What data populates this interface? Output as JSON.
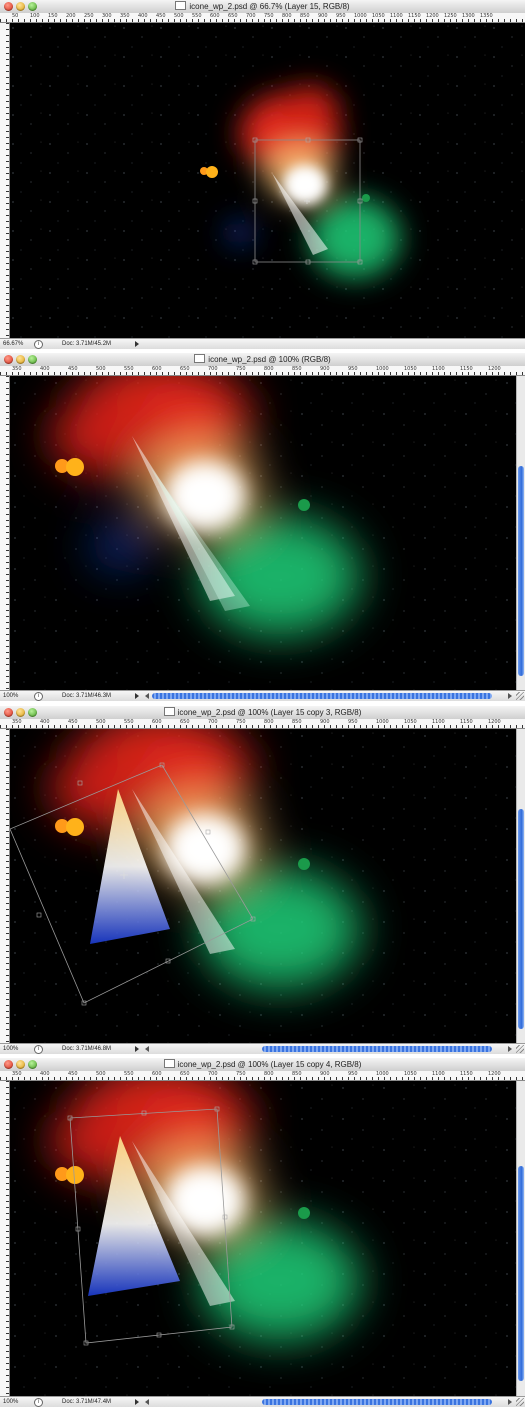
{
  "windows": [
    {
      "title": "icone_wp_2.psd @ 66.7% (Layer 15, RGB/8)",
      "zoom": "66.67%",
      "doc_size": "Doc: 3.71M/45.2M",
      "ruler_ticks": [
        "50",
        "100",
        "150",
        "200",
        "250",
        "300",
        "350",
        "400",
        "450",
        "500",
        "550",
        "600",
        "650",
        "700",
        "750",
        "800",
        "850",
        "900",
        "950",
        "1000",
        "1050",
        "1100",
        "1150",
        "1200",
        "1250",
        "1300",
        "1350"
      ],
      "has_hscroll": false,
      "has_vscroll": false
    },
    {
      "title": "icone_wp_2.psd @ 100% (RGB/8)",
      "zoom": "100%",
      "doc_size": "Doc: 3.71M/46.3M",
      "ruler_ticks": [
        "350",
        "400",
        "450",
        "500",
        "550",
        "600",
        "650",
        "700",
        "750",
        "800",
        "850",
        "900",
        "950",
        "1000",
        "1050",
        "1100",
        "1150",
        "1200"
      ],
      "has_hscroll": true,
      "has_vscroll": true
    },
    {
      "title": "icone_wp_2.psd @ 100% (Layer 15 copy 3, RGB/8)",
      "zoom": "100%",
      "doc_size": "Doc: 3.71M/46.8M",
      "ruler_ticks": [
        "350",
        "400",
        "450",
        "500",
        "550",
        "600",
        "650",
        "700",
        "750",
        "800",
        "850",
        "900",
        "950",
        "1000",
        "1050",
        "1100",
        "1150",
        "1200"
      ],
      "has_hscroll": true,
      "has_vscroll": true
    },
    {
      "title": "icone_wp_2.psd @ 100% (Layer 15 copy 4, RGB/8)",
      "zoom": "100%",
      "doc_size": "Doc: 3.71M/47.4M",
      "ruler_ticks": [
        "350",
        "400",
        "450",
        "500",
        "550",
        "600",
        "650",
        "700",
        "750",
        "800",
        "850",
        "900",
        "950",
        "1000",
        "1050",
        "1100",
        "1150",
        "1200"
      ],
      "has_hscroll": true,
      "has_vscroll": true
    }
  ],
  "icons": {
    "close": "close-icon",
    "minimize": "minimize-icon",
    "zoom": "zoom-icon",
    "document": "document-icon",
    "transform_center": "crosshair-icon"
  },
  "colors": {
    "nebula_red": "#e0281a",
    "nebula_orange": "#ff9a1a",
    "nebula_green": "#1fd07a",
    "nebula_blue": "#1a4ad8",
    "scroll_blue": "#3a74e0"
  }
}
